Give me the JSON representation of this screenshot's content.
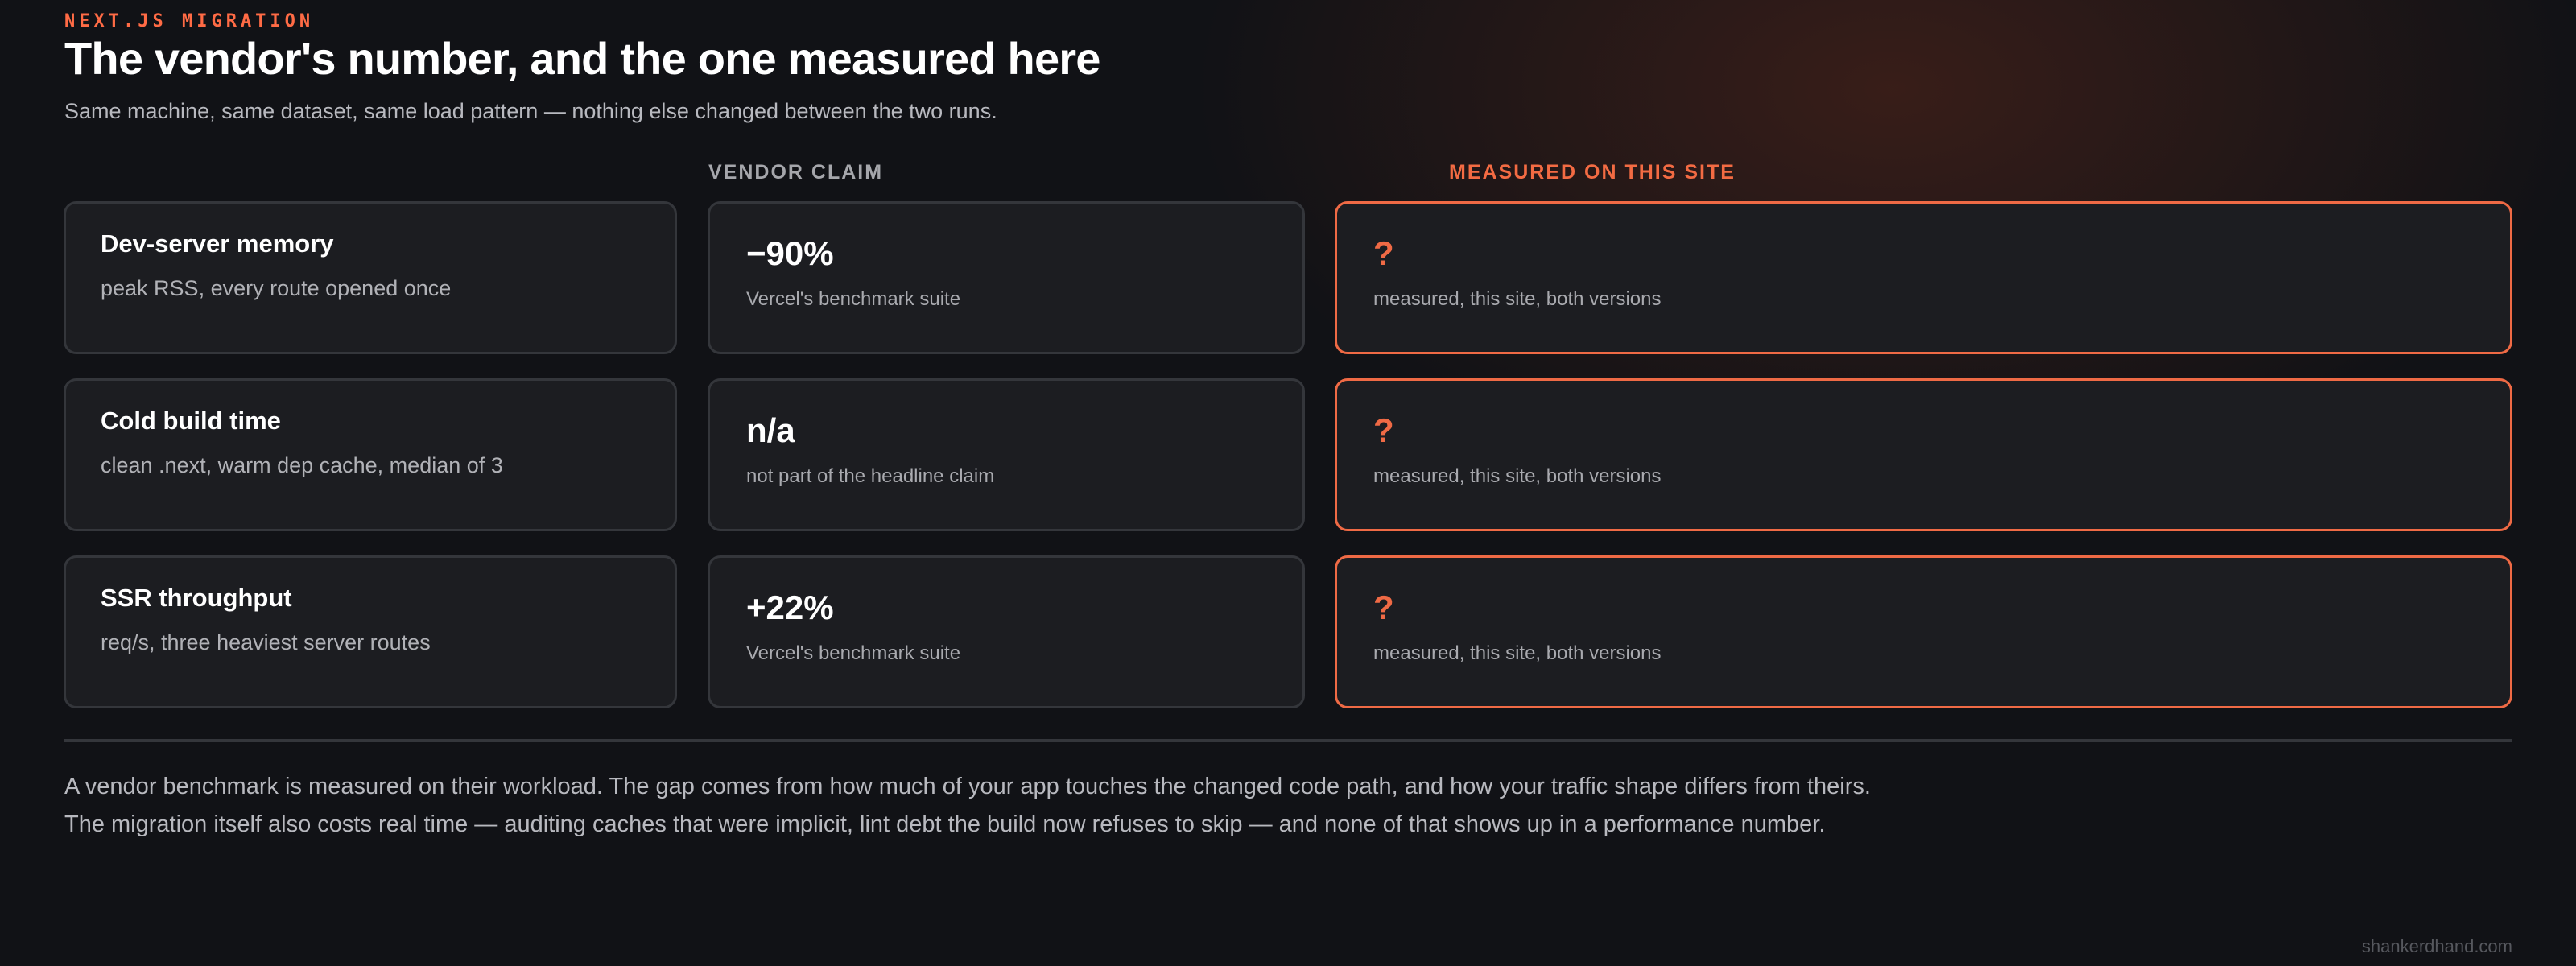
{
  "header": {
    "eyebrow": "NEXT.JS MIGRATION",
    "title": "The vendor's number, and the one measured here",
    "subtitle": "Same machine, same dataset, same load pattern — nothing else changed between the two runs."
  },
  "columns": {
    "vendor": "VENDOR CLAIM",
    "measured": "MEASURED ON THIS SITE"
  },
  "rows": [
    {
      "metric": "Dev-server memory",
      "detail": "peak RSS, every route opened once",
      "vendor_value": "−90%",
      "vendor_note": "Vercel's benchmark suite",
      "measured_value": "?",
      "measured_note": "measured, this site, both versions"
    },
    {
      "metric": "Cold build time",
      "detail": "clean .next, warm dep cache, median of 3",
      "vendor_value": "n/a",
      "vendor_note": "not part of the headline claim",
      "measured_value": "?",
      "measured_note": "measured, this site, both versions"
    },
    {
      "metric": "SSR throughput",
      "detail": "req/s, three heaviest server routes",
      "vendor_value": "+22%",
      "vendor_note": "Vercel's benchmark suite",
      "measured_value": "?",
      "measured_note": "measured, this site, both versions"
    }
  ],
  "footnote": {
    "line1": "A vendor benchmark is measured on their workload. The gap comes from how much of your app touches the changed code path, and how your traffic shape differs from theirs.",
    "line2": "The migration itself also costs real time — auditing caches that were implicit, lint debt the build now refuses to skip — and none of that shows up in a performance number."
  },
  "watermark": "shankerdhand.com",
  "colors": {
    "accent": "#ef6a45",
    "background": "#111216",
    "card": "#1c1d21",
    "card_border": "#34363b"
  }
}
